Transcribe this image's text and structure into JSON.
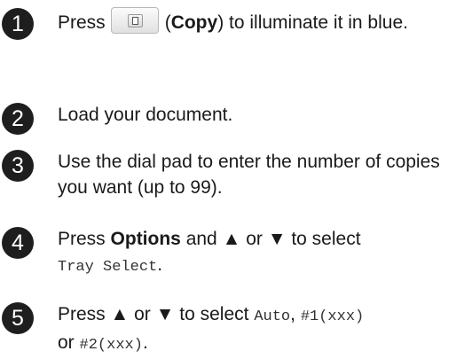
{
  "steps": [
    {
      "number": "1",
      "press": "Press",
      "key_icon": "copy-key-icon",
      "paren_open": "(",
      "key_label": "Copy",
      "paren_close_and_rest": ") to illuminate it in blue."
    },
    {
      "number": "2",
      "text": "Load your document."
    },
    {
      "number": "3",
      "text": "Use the dial pad to enter the number of copies you want (up to 99)."
    },
    {
      "number": "4",
      "press": "Press",
      "key_label": "Options",
      "middle": "and ▲ or ▼ to select",
      "menu_item": "Tray Select",
      "end": "."
    },
    {
      "number": "5",
      "lead": "Press ▲ or ▼ to select",
      "option_1": "Auto",
      "sep_1": ",",
      "option_2": "#1(xxx)",
      "sep_2": "or",
      "option_3": "#2(xxx)",
      "end": "."
    }
  ]
}
